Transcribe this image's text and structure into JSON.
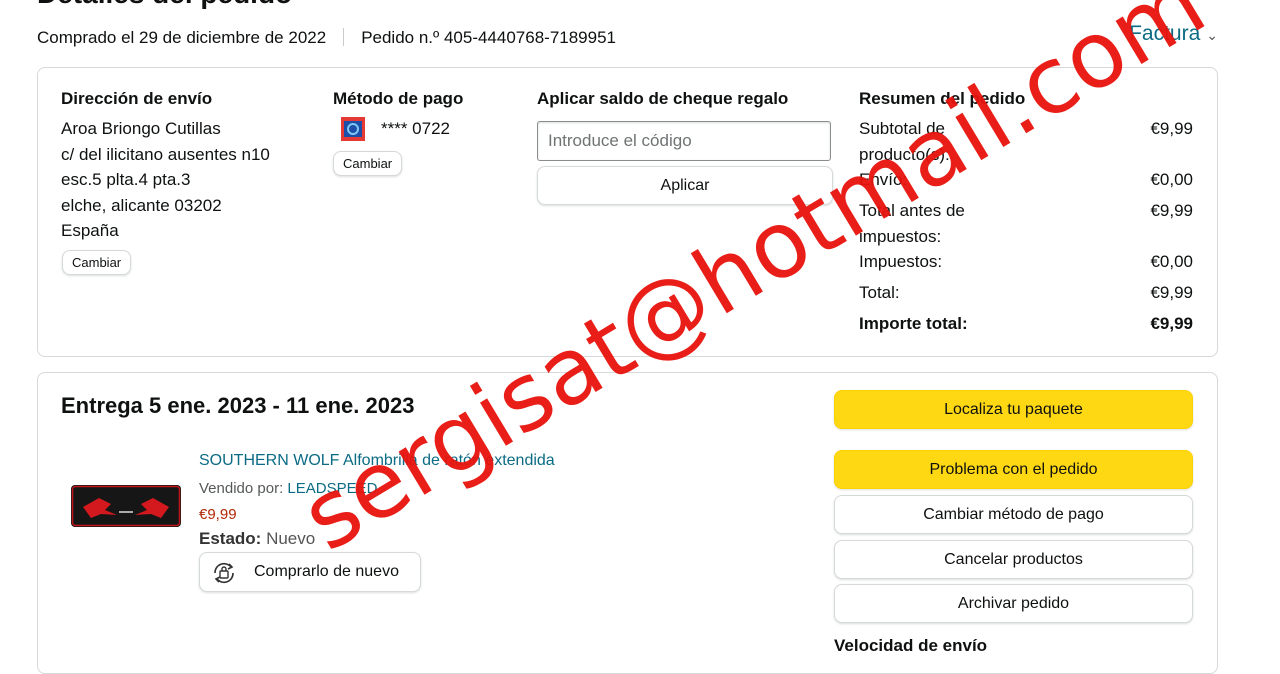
{
  "header": {
    "title": "Detalles del pedido",
    "purchased": "Comprado el 29 de diciembre de 2022",
    "order_number": "Pedido n.º 405-4440768-7189951",
    "invoice": "Factura"
  },
  "shipping": {
    "heading": "Dirección de envío",
    "lines": [
      "Aroa Briongo Cutillas",
      "c/ del ilicitano ausentes n10",
      "esc.5 plta.4 pta.3",
      "elche, alicante 03202",
      "España"
    ],
    "change": "Cambiar"
  },
  "payment": {
    "heading": "Método de pago",
    "card": "**** 0722",
    "change": "Cambiar"
  },
  "gift": {
    "heading": "Aplicar saldo de cheque regalo",
    "placeholder": "Introduce el código",
    "apply": "Aplicar"
  },
  "summary": {
    "heading": "Resumen del pedido",
    "rows": [
      {
        "label": "Subtotal de producto(s):",
        "value": "€9,99"
      },
      {
        "label": "Envío:",
        "value": "€0,00"
      },
      {
        "label": "Total antes de impuestos:",
        "value": "€9,99"
      },
      {
        "label": "Impuestos:",
        "value": "€0,00"
      },
      {
        "label": "Total:",
        "value": "€9,99"
      },
      {
        "label": "Importe total:",
        "value": "€9,99"
      }
    ]
  },
  "delivery": {
    "title": "Entrega 5 ene. 2023 - 11 ene. 2023",
    "item": {
      "name": "SOUTHERN WOLF Alfombrilla de ratón extendida",
      "seller_label": "Vendido por:",
      "seller": "LEADSPEED",
      "price": "€9,99",
      "condition_label": "Estado:",
      "condition": "Nuevo",
      "buy_again": "Comprarlo de nuevo"
    },
    "actions": [
      "Localiza tu paquete",
      "Problema con el pedido",
      "Cambiar método de pago",
      "Cancelar productos",
      "Archivar pedido"
    ],
    "speed": "Velocidad de envío"
  },
  "watermark": "sergisat@hotmail.com",
  "colors": {
    "accent_yellow": "#ffd814",
    "link": "#0b6b84",
    "price": "#b12704",
    "watermark": "#e8130c"
  }
}
